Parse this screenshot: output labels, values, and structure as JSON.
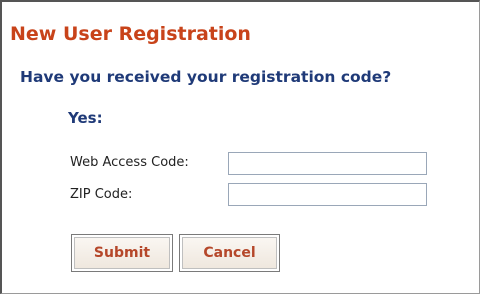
{
  "form": {
    "title": "New User Registration",
    "question": "Have you received your registration code?",
    "answer_heading": "Yes:",
    "fields": [
      {
        "label": "Web Access Code:",
        "value": "",
        "placeholder": ""
      },
      {
        "label": "ZIP Code:",
        "value": "",
        "placeholder": ""
      }
    ],
    "submit_label": "Submit",
    "cancel_label": "Cancel"
  },
  "colors": {
    "title": "#c8431a",
    "heading": "#1f3a78",
    "button_text": "#b5472a",
    "border": "#555555"
  }
}
